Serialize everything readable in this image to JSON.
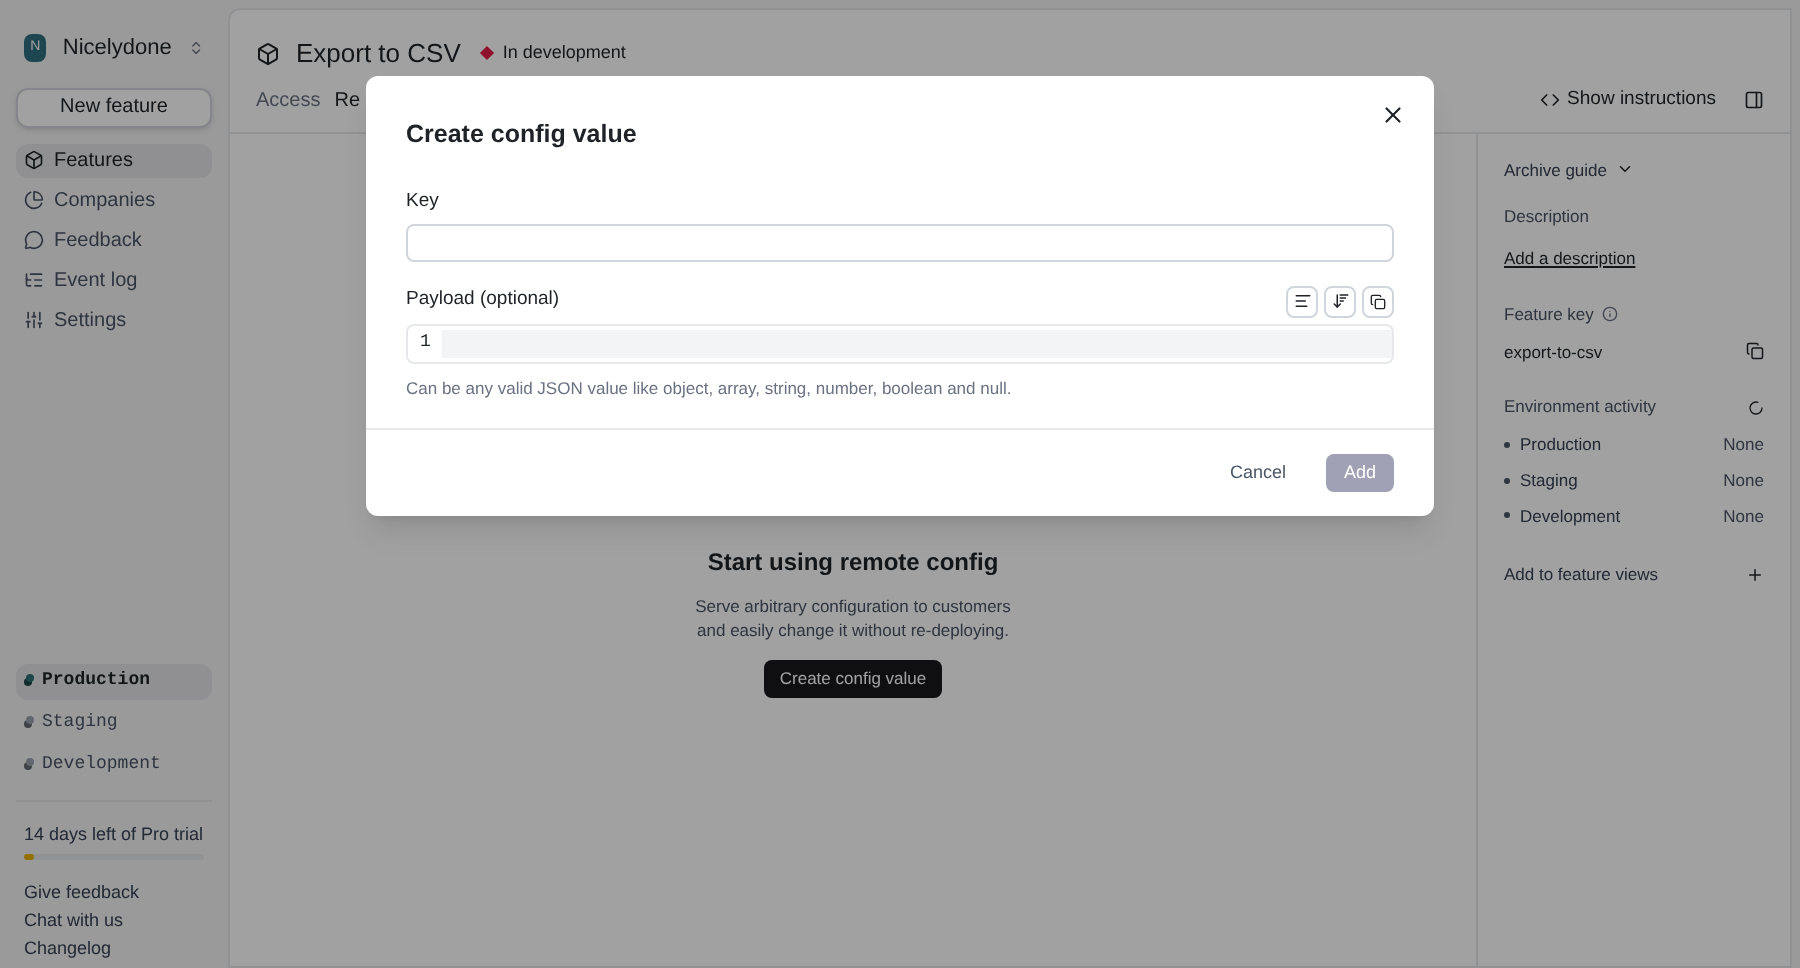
{
  "workspace": {
    "initial": "N",
    "name": "Nicelydone"
  },
  "new_feature_button": "New feature",
  "nav": [
    {
      "label": "Features",
      "kind": "box",
      "selected": true
    },
    {
      "label": "Companies",
      "kind": "pie",
      "selected": false
    },
    {
      "label": "Feedback",
      "kind": "bubble",
      "selected": false
    },
    {
      "label": "Event log",
      "kind": "log",
      "selected": false
    },
    {
      "label": "Settings",
      "kind": "sliders",
      "selected": false
    }
  ],
  "environments": [
    {
      "label": "Production",
      "selected": true,
      "color": "#1e4648"
    },
    {
      "label": "Staging",
      "selected": false,
      "color": "#62676e"
    },
    {
      "label": "Development",
      "selected": false,
      "color": "#62676e"
    }
  ],
  "trial": {
    "text": "14 days left of Pro trial",
    "level": 0.06
  },
  "footer_links": [
    "Give feedback",
    "Chat with us",
    "Changelog"
  ],
  "header": {
    "title": "Export to CSV",
    "status": {
      "label": "In development",
      "color": "#8e122d"
    },
    "show_instructions": "Show instructions"
  },
  "tabs": [
    {
      "label": "Access",
      "selected": false
    },
    {
      "label": "Re",
      "selected": true
    }
  ],
  "empty_state": {
    "title": "Start using remote config",
    "description": "Serve arbitrary configuration to customers and easily change it without re-deploying.",
    "button": "Create config value"
  },
  "side_panel": {
    "archive_guide": "Archive guide",
    "description_label": "Description",
    "add_description": "Add a description",
    "feature_key_label": "Feature key",
    "feature_key": "export-to-csv",
    "environment_activity": "Environment activity",
    "activity": [
      {
        "name": "Production",
        "value": "None"
      },
      {
        "name": "Staging",
        "value": "None"
      },
      {
        "name": "Development",
        "value": "None"
      }
    ],
    "add_to_views": "Add to feature views"
  },
  "modal": {
    "title": "Create config value",
    "key_label": "Key",
    "payload_label": "Payload (optional)",
    "line_number": "1",
    "hint": "Can be any valid JSON value like object, array, string, number, boolean and null.",
    "cancel": "Cancel",
    "submit": {
      "label": "Add",
      "disabled": true
    }
  }
}
